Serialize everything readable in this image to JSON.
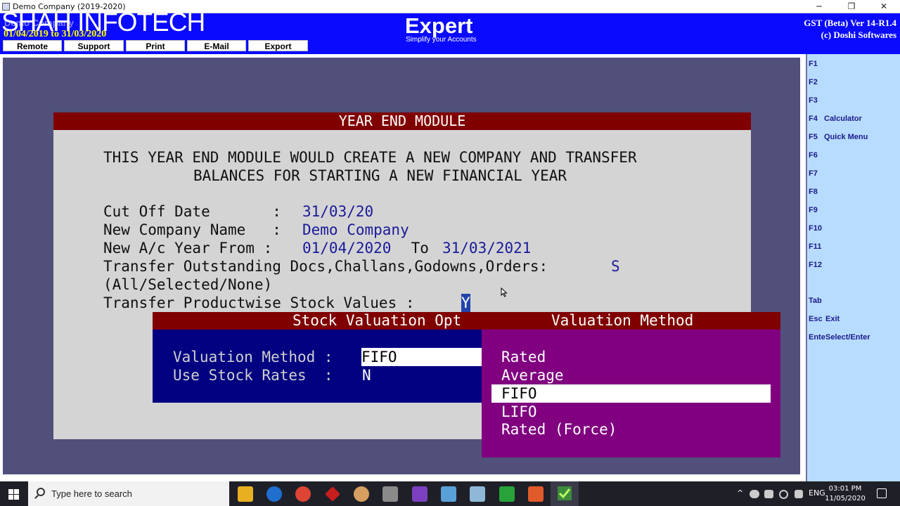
{
  "window": {
    "title": "Demo Company (2019-2020)",
    "minimize": "─",
    "maximize": "❐",
    "close": "✕"
  },
  "header": {
    "watermark": "SHAH INFOTECH",
    "company_ghost": "Demo Company",
    "period": "01/04/2019 to 31/03/2020",
    "buttons": [
      "Remote",
      "Support",
      "Print",
      "E-Mail",
      "Export"
    ],
    "logo": "Expert",
    "tagline": "Simplify your Accounts",
    "version": "GST (Beta) Ver 14-R1.4",
    "copyright": "(c) Doshi Softwares"
  },
  "function_keys": [
    {
      "key": "F1",
      "label": ""
    },
    {
      "key": "F2",
      "label": ""
    },
    {
      "key": "F3",
      "label": ""
    },
    {
      "key": "F4",
      "label": "Calculator"
    },
    {
      "key": "F5",
      "label": "Quick Menu"
    },
    {
      "key": "F6",
      "label": ""
    },
    {
      "key": "F7",
      "label": ""
    },
    {
      "key": "F8",
      "label": ""
    },
    {
      "key": "F9",
      "label": ""
    },
    {
      "key": "F10",
      "label": ""
    },
    {
      "key": "F11",
      "label": ""
    },
    {
      "key": "F12",
      "label": ""
    },
    {
      "key": "Tab",
      "label": ""
    },
    {
      "key": "Esc",
      "label": "Exit"
    },
    {
      "key": "Ente",
      "label": "Select/Enter"
    }
  ],
  "dialog": {
    "title": "YEAR END MODULE",
    "intro_line1": "THIS YEAR END MODULE WOULD CREATE A NEW COMPANY AND TRANSFER",
    "intro_line2": "BALANCES FOR STARTING A NEW FINANCIAL YEAR",
    "cutoff_label": "Cut Off Date       : ",
    "cutoff_value": "31/03/20",
    "newco_label": "New Company Name   : ",
    "newco_value": "Demo Company",
    "year_label": "New A/c Year From : ",
    "year_from": "01/04/2020",
    "year_to_label": " To ",
    "year_to": "31/03/2021",
    "transfer_label": "Transfer Outstanding Docs,Challans,Godowns,Orders: ",
    "transfer_value": "S",
    "transfer_hint": "(All/Selected/None)",
    "stock_label": "Transfer Productwise Stock Values : ",
    "stock_value": "Y"
  },
  "stock_options": {
    "title": "Stock Valuation Opt",
    "method_label": "Valuation Method : ",
    "method_value": "FIFO",
    "rates_label": "Use Stock Rates  : ",
    "rates_value": "N"
  },
  "valuation_menu": {
    "title": "Valuation Method",
    "items": [
      "Rated",
      "Average",
      "FIFO",
      "LIFO",
      "Rated (Force)"
    ],
    "selected": "FIFO"
  },
  "taskbar": {
    "search_placeholder": "Type here to search",
    "tray_lang": "ENG",
    "time": "03:01 PM",
    "date": "11/05/2020",
    "caret": "^"
  },
  "colors": {
    "header_blue": "#0a0aff",
    "canvas": "#50507a",
    "dialog_bg": "#d4d4d4",
    "title_red": "#800000",
    "panel_navy": "#000080",
    "menu_purple": "#800080",
    "fkey_panel": "#b8dcff"
  }
}
